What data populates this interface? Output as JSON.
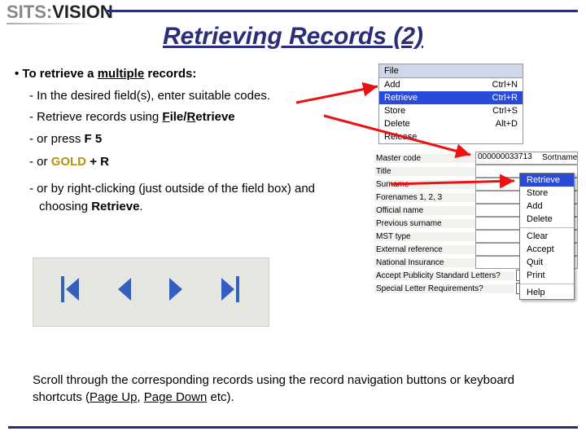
{
  "logo": {
    "sits": "SITS:",
    "vision": "VISION"
  },
  "title": "Retrieving Records (2)",
  "lead": {
    "pre": "To retrieve a ",
    "mul": "multiple",
    "post": " records:"
  },
  "b": {
    "i1": "In the desired field(s), enter suitable codes.",
    "i2_a": "Retrieve records using ",
    "i2_f": "F",
    "i2_file": "ile/",
    "i2_r": "R",
    "i2_ret": "etrieve",
    "i3_a": "or press ",
    "i3_b": "F 5",
    "i4_a": "or ",
    "i4_g": "GOLD",
    "i4_b": " + R",
    "i5_a": "or by right-clicking (just outside of the field box) and choosing ",
    "i5_b": "Retrieve",
    "i5_c": "."
  },
  "scroll": {
    "a": "Scroll through the corresponding records using the record navigation buttons or keyboard shortcuts (",
    "pu": "Page Up",
    "sep": ", ",
    "pd": "Page Down",
    "b": " etc)."
  },
  "menu": {
    "hdr": "File",
    "items": [
      {
        "l": "Add",
        "r": "Ctrl+N"
      },
      {
        "l": "Retrieve",
        "r": "Ctrl+R"
      },
      {
        "l": "Store",
        "r": "Ctrl+S"
      },
      {
        "l": "Delete",
        "r": "Alt+D"
      },
      {
        "l": "Release",
        "r": ""
      }
    ]
  },
  "form": {
    "master_label": "Master code",
    "master_val": "000000033713",
    "labels": [
      "Title",
      "Surname",
      "Forenames 1, 2, 3",
      "Official name",
      "Previous surname",
      "MST type",
      "External reference",
      "National Insurance",
      "Accept Publicity Standard Letters?",
      "Special Letter Requirements?"
    ],
    "sortname": "Sortname"
  },
  "ctx": {
    "items": [
      "Retrieve",
      "Store",
      "Add",
      "Delete"
    ],
    "items2": [
      "Clear",
      "Accept",
      "Quit",
      "Print"
    ],
    "items3": [
      "Help"
    ]
  }
}
